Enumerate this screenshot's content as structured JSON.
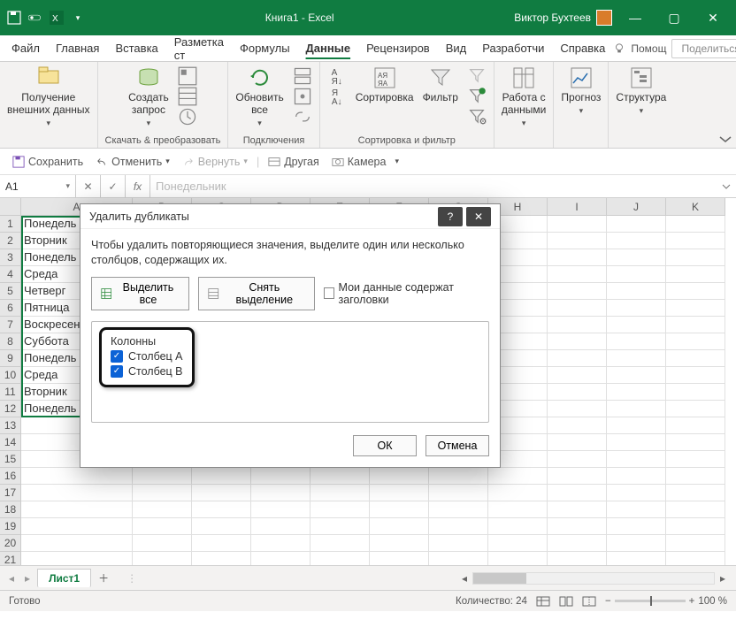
{
  "titlebar": {
    "title": "Книга1 - Excel",
    "user": "Виктор Бухтеев"
  },
  "win": {
    "min": "—",
    "max": "▢",
    "close": "✕"
  },
  "menu": {
    "file": "Файл",
    "home": "Главная",
    "insert": "Вставка",
    "layout": "Разметка ст",
    "formulas": "Формулы",
    "data": "Данные",
    "review": "Рецензиров",
    "view": "Вид",
    "dev": "Разработчи",
    "help": "Справка",
    "tellme": "Помощ",
    "share": "Поделиться"
  },
  "ribbon": {
    "external": "Получение\nвнешних данных",
    "query": "Создать\nзапрос",
    "group_query": "Скачать & преобразовать",
    "refresh": "Обновить\nвсе",
    "group_conn": "Подключения",
    "sort": "Сортировка",
    "filter": "Фильтр",
    "group_sort": "Сортировка и фильтр",
    "datawork": "Работа с\nданными",
    "forecast": "Прогноз",
    "outline": "Структура"
  },
  "qat": {
    "save": "Сохранить",
    "undo": "Отменить",
    "redo": "Вернуть",
    "other": "Другая",
    "camera": "Камера"
  },
  "formula": {
    "ref": "A1",
    "value": "Понедельник"
  },
  "columns": [
    "A",
    "B",
    "C",
    "D",
    "E",
    "F",
    "G",
    "H",
    "I",
    "J",
    "K"
  ],
  "rows_visible": 21,
  "data_cells": [
    "Понедель",
    "Вторник",
    "Понедель",
    "Среда",
    "Четверг",
    "Пятница",
    "Воскресен",
    "Суббота",
    "Понедель",
    "Среда",
    "Вторник",
    "Понедель"
  ],
  "tabs": {
    "sheet": "Лист1"
  },
  "status": {
    "ready": "Готово",
    "count_label": "Количество:",
    "count": "24",
    "zoom": "100 %"
  },
  "dialog": {
    "title": "Удалить дубликаты",
    "msg": "Чтобы удалить повторяющиеся значения, выделите один или несколько столбцов, содержащих их.",
    "select_all": "Выделить все",
    "deselect": "Снять выделение",
    "headers": "Мои данные содержат заголовки",
    "columns_label": "Колонны",
    "col_a": "Столбец A",
    "col_b": "Столбец B",
    "ok": "ОК",
    "cancel": "Отмена"
  }
}
